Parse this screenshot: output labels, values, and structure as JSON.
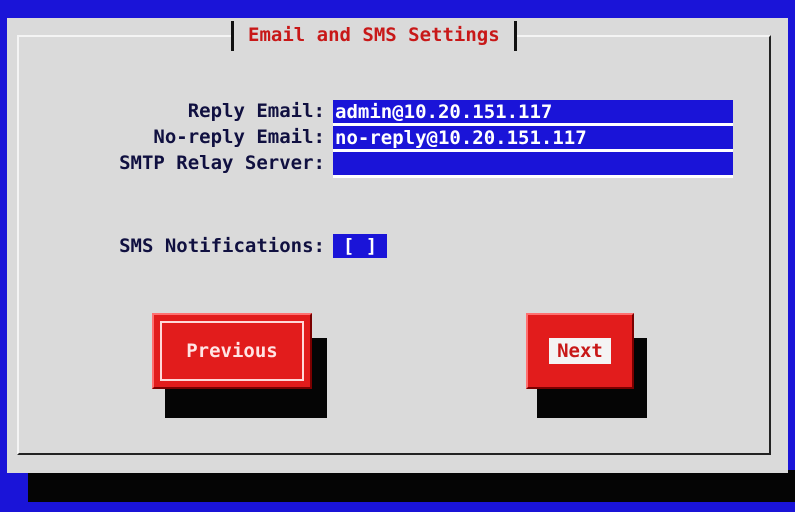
{
  "dialog": {
    "title": "Email and SMS Settings"
  },
  "fields": {
    "reply_email": {
      "label": "Reply Email:",
      "value": "admin@10.20.151.117"
    },
    "noreply_email": {
      "label": "No-reply Email:",
      "value": "no-reply@10.20.151.117"
    },
    "smtp_relay": {
      "label": "SMTP Relay Server:",
      "value": ""
    }
  },
  "sms": {
    "label": "SMS Notifications:",
    "checkbox": "[ ]"
  },
  "buttons": {
    "previous": "Previous",
    "next": "Next"
  },
  "colors": {
    "background": "#1a14d8",
    "dialog": "#dadada",
    "accent_red": "#e21c1c",
    "title_text": "#c81818",
    "field_bg": "#1a14d8"
  }
}
